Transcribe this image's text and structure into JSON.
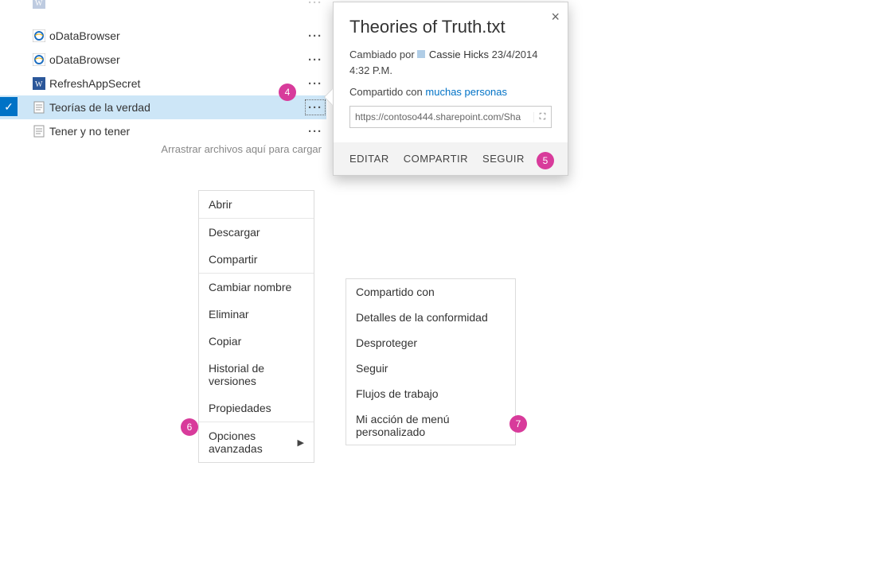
{
  "files": [
    {
      "name": "",
      "icon": "word"
    },
    {
      "name": "oDataBrowser",
      "icon": "ie"
    },
    {
      "name": "oDataBrowser",
      "icon": "ie"
    },
    {
      "name": "RefreshAppSecret",
      "icon": "word"
    },
    {
      "name": "Teorías de la verdad",
      "icon": "text",
      "selected": true
    },
    {
      "name": "Tener y no tener",
      "icon": "text"
    }
  ],
  "drop_hint": "Arrastrar archivos aquí para cargar",
  "callout": {
    "title": "Theories of Truth.txt",
    "changed_label": "Cambiado por",
    "user": "Cassie Hicks",
    "date": "23/4/2014 4:32 P.M.",
    "shared_label": "Compartido con",
    "shared_link": "muchas personas",
    "url": "https://contoso444.sharepoint.com/Sha",
    "actions": {
      "edit": "EDITAR",
      "share": "COMPARTIR",
      "follow": "SEGUIR"
    }
  },
  "menu1": {
    "open": "Abrir",
    "download": "Descargar",
    "share": "Compartir",
    "rename": "Cambiar nombre",
    "delete": "Eliminar",
    "copy": "Copiar",
    "versions": "Historial de versiones",
    "properties": "Propiedades",
    "advanced": "Opciones avanzadas"
  },
  "menu2": {
    "shared_with": "Compartido con",
    "compliance": "Detalles de la conformidad",
    "checkout": "Desproteger",
    "follow": "Seguir",
    "workflows": "Flujos de trabajo",
    "custom": "Mi acción de menú personalizado"
  },
  "badges": {
    "b4": "4",
    "b5": "5",
    "b6": "6",
    "b7": "7"
  }
}
